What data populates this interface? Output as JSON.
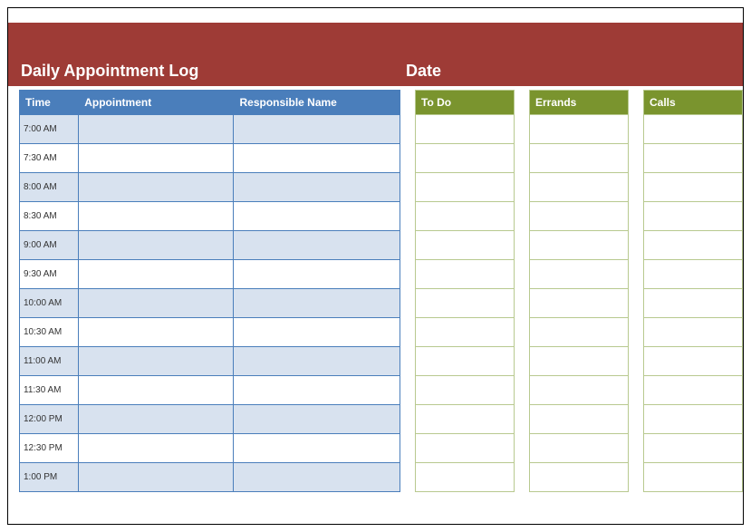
{
  "banner": {
    "title": "Daily Appointment Log",
    "date_label": "Date"
  },
  "appointment_table": {
    "headers": {
      "time": "Time",
      "appointment": "Appointment",
      "responsible": "Responsible Name"
    },
    "rows": [
      {
        "time": "7:00 AM",
        "appointment": "",
        "responsible": ""
      },
      {
        "time": "7:30 AM",
        "appointment": "",
        "responsible": ""
      },
      {
        "time": "8:00 AM",
        "appointment": "",
        "responsible": ""
      },
      {
        "time": "8:30 AM",
        "appointment": "",
        "responsible": ""
      },
      {
        "time": "9:00 AM",
        "appointment": "",
        "responsible": ""
      },
      {
        "time": "9:30 AM",
        "appointment": "",
        "responsible": ""
      },
      {
        "time": "10:00 AM",
        "appointment": "",
        "responsible": ""
      },
      {
        "time": "10:30 AM",
        "appointment": "",
        "responsible": ""
      },
      {
        "time": "11:00 AM",
        "appointment": "",
        "responsible": ""
      },
      {
        "time": "11:30 AM",
        "appointment": "",
        "responsible": ""
      },
      {
        "time": "12:00 PM",
        "appointment": "",
        "responsible": ""
      },
      {
        "time": "12:30 PM",
        "appointment": "",
        "responsible": ""
      },
      {
        "time": "1:00 PM",
        "appointment": "",
        "responsible": ""
      }
    ]
  },
  "side_columns": [
    {
      "header": "To Do",
      "row_count": 13
    },
    {
      "header": "Errands",
      "row_count": 13
    },
    {
      "header": "Calls",
      "row_count": 13
    }
  ]
}
